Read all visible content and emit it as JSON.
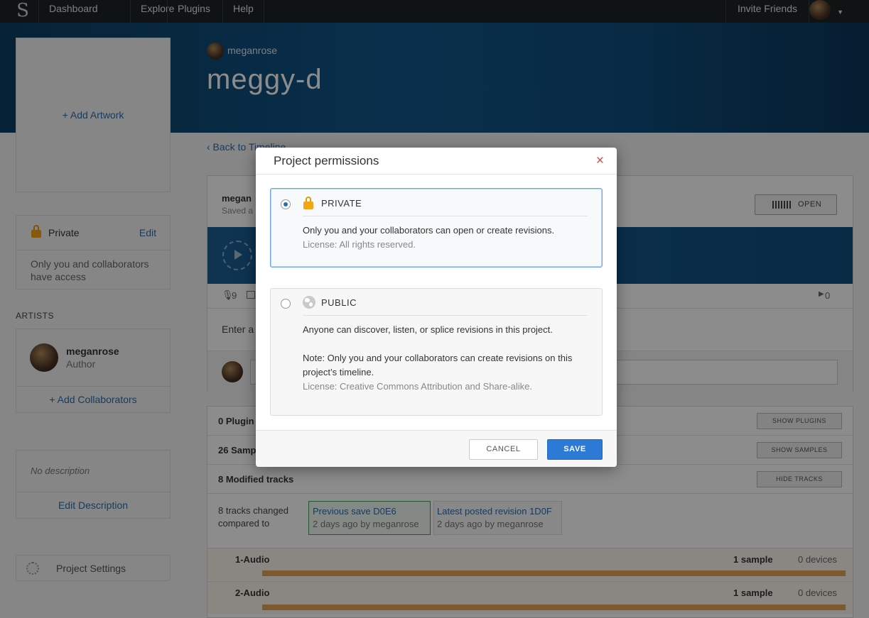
{
  "nav": {
    "logo": "S",
    "items": [
      "Dashboard",
      "Explore",
      "Plugins",
      "Help"
    ],
    "invite": "Invite Friends"
  },
  "hero": {
    "username": "meganrose",
    "project_title": "meggy-d"
  },
  "sidebar": {
    "add_artwork": "+ Add Artwork",
    "privacy": {
      "label": "Private",
      "edit": "Edit",
      "description": "Only you and collaborators have access"
    },
    "artists_heading": "ARTISTS",
    "artist": {
      "name": "meganrose",
      "role": "Author"
    },
    "add_collaborators": "+ Add Collaborators",
    "no_description": "No description",
    "edit_description": "Edit Description",
    "project_settings": "Project Settings"
  },
  "main": {
    "back_link": "‹ Back to Timeline",
    "revision_user": "megan",
    "saved_prefix": "Saved a",
    "open_button": "OPEN",
    "mic_count": "9",
    "plays_count": "0",
    "comment_prefix": "Enter a",
    "plugins_row": "0 Plugin",
    "samples_row": "26 Samp",
    "tracks_row": "8 Modified tracks",
    "show_plugins": "SHOW PLUGINS",
    "show_samples": "SHOW SAMPLES",
    "hide_tracks": "HIDE TRACKS",
    "tracks_changed": "8 tracks changed compared to",
    "prev_save": {
      "title": "Previous save D0E6",
      "meta": "2 days ago by meganrose"
    },
    "latest_revision": {
      "title": "Latest posted revision 1D0F",
      "meta": "2 days ago by meganrose"
    },
    "tracks": [
      {
        "name": "1-Audio",
        "samples": "1 sample",
        "devices": "0 devices"
      },
      {
        "name": "2-Audio",
        "samples": "1 sample",
        "devices": "0 devices"
      }
    ]
  },
  "modal": {
    "title": "Project permissions",
    "close": "×",
    "private": {
      "title": "PRIVATE",
      "text": "Only you and your collaborators can open or create revisions.",
      "license": "License: All rights reserved.",
      "selected": true
    },
    "public": {
      "title": "PUBLIC",
      "text": "Anyone can discover, listen, or splice revisions in this project.",
      "note": "Note: Only you and your collaborators can create revisions on this project’s timeline.",
      "license": "License: Creative Commons Attribution and Share-alike.",
      "selected": false
    },
    "cancel": "CANCEL",
    "save": "SAVE"
  },
  "colors": {
    "accent": "#2d7ad6",
    "lock": "#f2a614",
    "close": "#d14a3a",
    "track_bar": "#e3a25b",
    "hero_blue": "#12578b"
  }
}
